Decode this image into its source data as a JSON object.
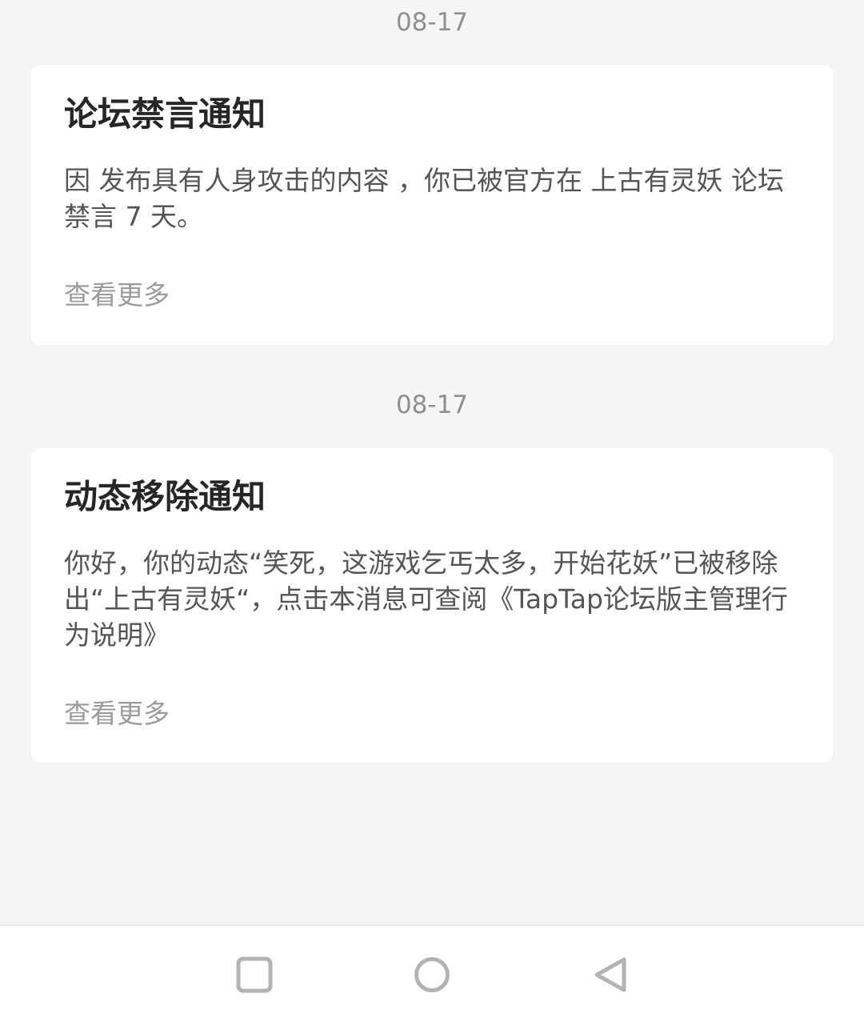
{
  "notifications": [
    {
      "date": "08-17",
      "title": "论坛禁言通知",
      "body": "因 发布具有人身攻击的内容 ，你已被官方在 上古有灵妖 论坛禁言 7 天。",
      "more_label": "查看更多"
    },
    {
      "date": "08-17",
      "title": "动态移除通知",
      "body": "你好，你的动态“笑死，这游戏乞丐太多，开始花妖”已被移除出“上古有灵妖“，点击本消息可查阅《TapTap论坛版主管理行为说明》",
      "more_label": "查看更多"
    }
  ],
  "navbar": {
    "buttons": [
      "recent-apps-icon",
      "home-icon",
      "back-icon"
    ]
  },
  "colors": {
    "background": "#f4f5f7",
    "card": "#ffffff",
    "title": "#262626",
    "body": "#555555",
    "muted": "#9b9b9b",
    "nav_icon": "#b3b3b3"
  }
}
